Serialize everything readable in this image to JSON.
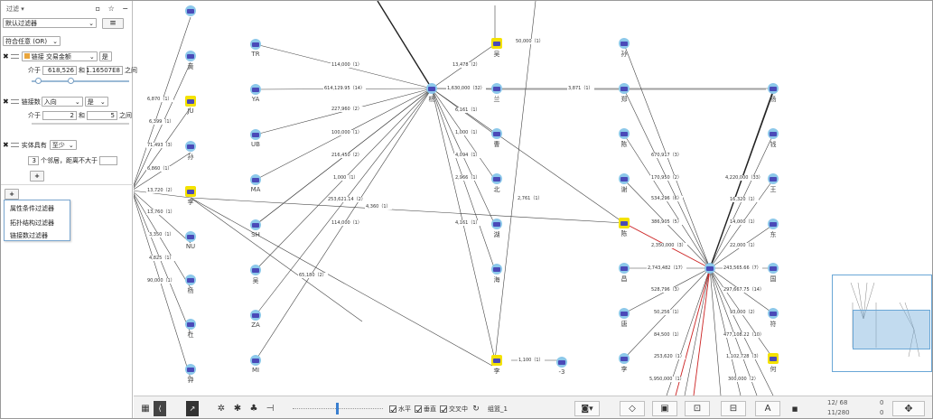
{
  "panel": {
    "title": "过滤 ▾",
    "filter_dropdown": "默认过滤器",
    "menu_icon": "≡",
    "logic": "符合任意 (OR)",
    "link_label": "链接",
    "link_type": "交易金额",
    "is_label": "是",
    "between": "介于",
    "and": "和",
    "between_suffix": "之间",
    "range_min": "618,526",
    "range_max": "1.16507E8",
    "link_count_label": "链接数",
    "direction": "入向",
    "count_min": "2",
    "count_max": "5",
    "entity_has": "实体具有",
    "at_least": "至少",
    "entity_count": "3",
    "neighbors_text": "个邻居，距离不大于",
    "add_plus": "+",
    "menu_items": [
      "属性条件过滤器",
      "拓扑结构过滤器",
      "链接数过滤器"
    ]
  },
  "nodes": {
    "c1": [
      "",
      "黄",
      "JU",
      "孙",
      "李",
      "NU",
      "杨",
      "杜",
      "钟"
    ],
    "c2": [
      "TR",
      "YA",
      "UB",
      "MA",
      "SH",
      "吴",
      "ZA",
      "MI"
    ],
    "hub1": "杨",
    "c3": [
      "吴",
      "兰",
      "曹",
      "北",
      "湖",
      "海"
    ],
    "c4": [
      "孙",
      "郑",
      "陈",
      "谢",
      "陈",
      "昌",
      "唐",
      "李"
    ],
    "c5": [
      "杨",
      "钱",
      "王",
      "东",
      "国",
      "符",
      "何"
    ],
    "bottom_li": "李",
    "bottom_3": "-3"
  },
  "edges": {
    "left": [
      "6,870（1）",
      "6,399（1）",
      "71,493（3）",
      "6,860（1）",
      "13,720（2）",
      "13,760（1）",
      "3,350（1）",
      "4,825（1）",
      "90,000（1）"
    ],
    "hub1": [
      "114,000（1）",
      "614,129.95（14）",
      "227,960（2）",
      "100,000（1）",
      "216,450（2）",
      "1,000（1）",
      "253,621.14（2）",
      "114,000（1）",
      "65,180（2）"
    ],
    "mid": [
      "13,478（2）",
      "1,630,000（32）",
      "6,161（1）",
      "1,000（1）",
      "4,094（1）",
      "2,966（1）",
      "4,161（1）",
      "4,360（1）",
      "2,761（1）",
      "50,000（1）",
      "3,871（1）"
    ],
    "hub2": [
      "670,917（3）",
      "170,950（2）",
      "534,296（6）",
      "386,905（5）",
      "2,350,000（3）",
      "2,743,482（17）",
      "528,796（3）",
      "50,256（1）",
      "84,500（1）",
      "253,620（1）",
      "5,950,000（1）"
    ],
    "right": [
      "4,220,000（33）",
      "16,320（1）",
      "14,000（1）",
      "22,000（1）",
      "243,565.66（7）",
      "297,667.75（14）",
      "93,000（2）",
      "477,108.22（10）",
      "1,102,728（3）",
      "300,000（2）"
    ],
    "bottom": "1,100（1）"
  },
  "bottombar": {
    "horizontal": "水平",
    "vertical": "垂直",
    "intersection": "交叉中",
    "group": "组篮_1",
    "count1": "12/ 68",
    "count2": "11/280",
    "zero1": "0",
    "zero2": "0"
  }
}
